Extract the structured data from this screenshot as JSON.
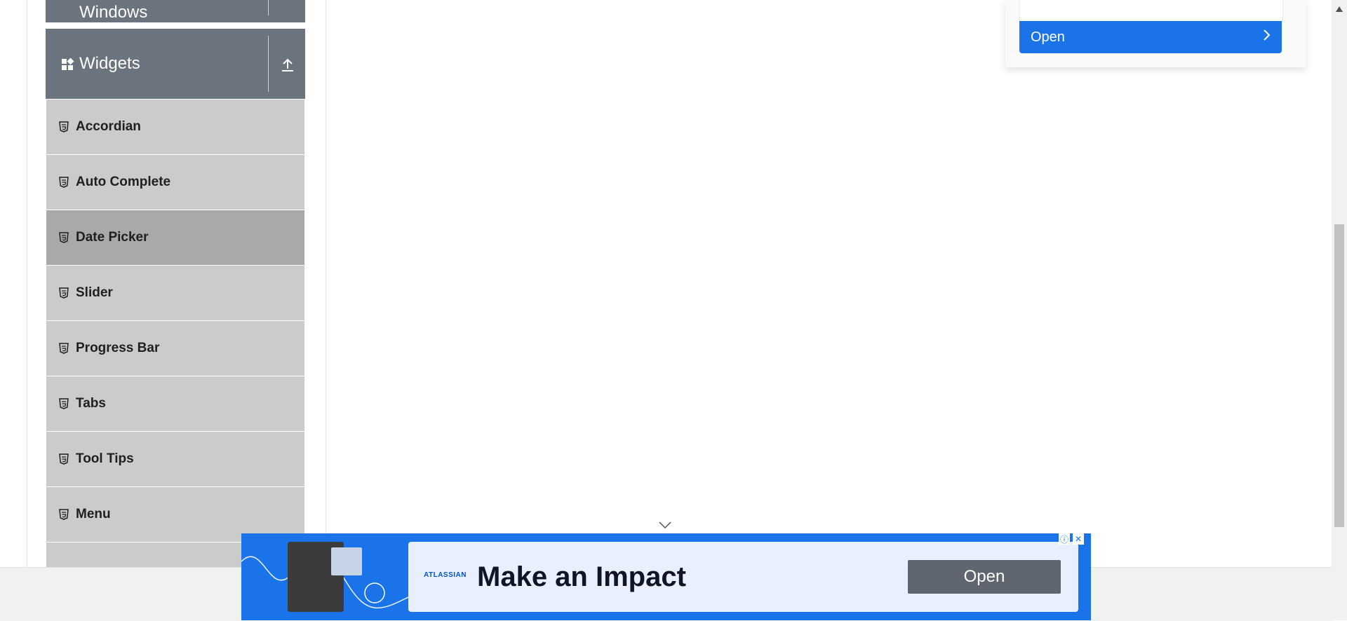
{
  "sidebar": {
    "windows_group": {
      "title": "Windows"
    },
    "widgets_group": {
      "title": "Widgets"
    },
    "items": [
      {
        "label": "Accordian",
        "active": false
      },
      {
        "label": "Auto Complete",
        "active": false
      },
      {
        "label": "Date Picker",
        "active": true
      },
      {
        "label": "Slider",
        "active": false
      },
      {
        "label": "Progress Bar",
        "active": false
      },
      {
        "label": "Tabs",
        "active": false
      },
      {
        "label": "Tool Tips",
        "active": false
      },
      {
        "label": "Menu",
        "active": false
      }
    ]
  },
  "top_ad": {
    "open_label": "Open"
  },
  "bottom_ad": {
    "brand": "ATLASSIAN",
    "headline": "Make an Impact",
    "open_label": "Open"
  },
  "colors": {
    "group_header": "#6b737e",
    "menu_item": "#cbcbcb",
    "menu_item_active": "#a9a9a9",
    "ad_blue": "#1a73e8"
  }
}
